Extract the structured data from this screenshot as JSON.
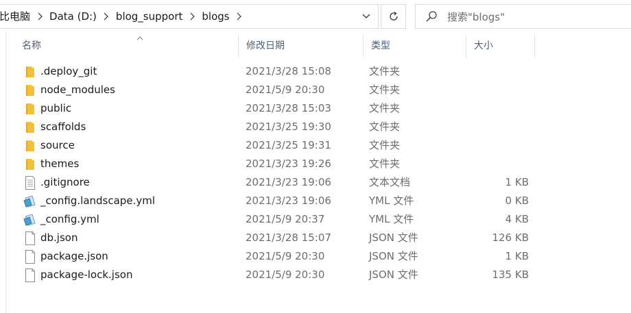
{
  "breadcrumbs": [
    "比电脑",
    "Data (D:)",
    "blog_support",
    "blogs"
  ],
  "search": {
    "placeholder": "搜索\"blogs\""
  },
  "columns": {
    "name": "名称",
    "modified": "修改日期",
    "type": "类型",
    "size": "大小"
  },
  "files": [
    {
      "name": ".deploy_git",
      "modified": "2021/3/28 15:08",
      "type": "文件夹",
      "size": "",
      "icon": "folder-icon"
    },
    {
      "name": "node_modules",
      "modified": "2021/5/9 20:30",
      "type": "文件夹",
      "size": "",
      "icon": "folder-icon"
    },
    {
      "name": "public",
      "modified": "2021/3/28 15:03",
      "type": "文件夹",
      "size": "",
      "icon": "folder-icon"
    },
    {
      "name": "scaffolds",
      "modified": "2021/3/25 19:30",
      "type": "文件夹",
      "size": "",
      "icon": "folder-icon"
    },
    {
      "name": "source",
      "modified": "2021/3/25 19:31",
      "type": "文件夹",
      "size": "",
      "icon": "folder-icon"
    },
    {
      "name": "themes",
      "modified": "2021/3/23 19:26",
      "type": "文件夹",
      "size": "",
      "icon": "folder-icon"
    },
    {
      "name": ".gitignore",
      "modified": "2021/3/23 19:06",
      "type": "文本文档",
      "size": "1 KB",
      "icon": "text-file-icon"
    },
    {
      "name": "_config.landscape.yml",
      "modified": "2021/3/23 19:06",
      "type": "YML 文件",
      "size": "0 KB",
      "icon": "yml-file-icon"
    },
    {
      "name": "_config.yml",
      "modified": "2021/5/9 20:37",
      "type": "YML 文件",
      "size": "4 KB",
      "icon": "yml-file-icon"
    },
    {
      "name": "db.json",
      "modified": "2021/3/28 15:07",
      "type": "JSON 文件",
      "size": "126 KB",
      "icon": "blank-file-icon"
    },
    {
      "name": "package.json",
      "modified": "2021/5/9 20:30",
      "type": "JSON 文件",
      "size": "1 KB",
      "icon": "blank-file-icon"
    },
    {
      "name": "package-lock.json",
      "modified": "2021/5/9 20:30",
      "type": "JSON 文件",
      "size": "135 KB",
      "icon": "blank-file-icon"
    }
  ]
}
